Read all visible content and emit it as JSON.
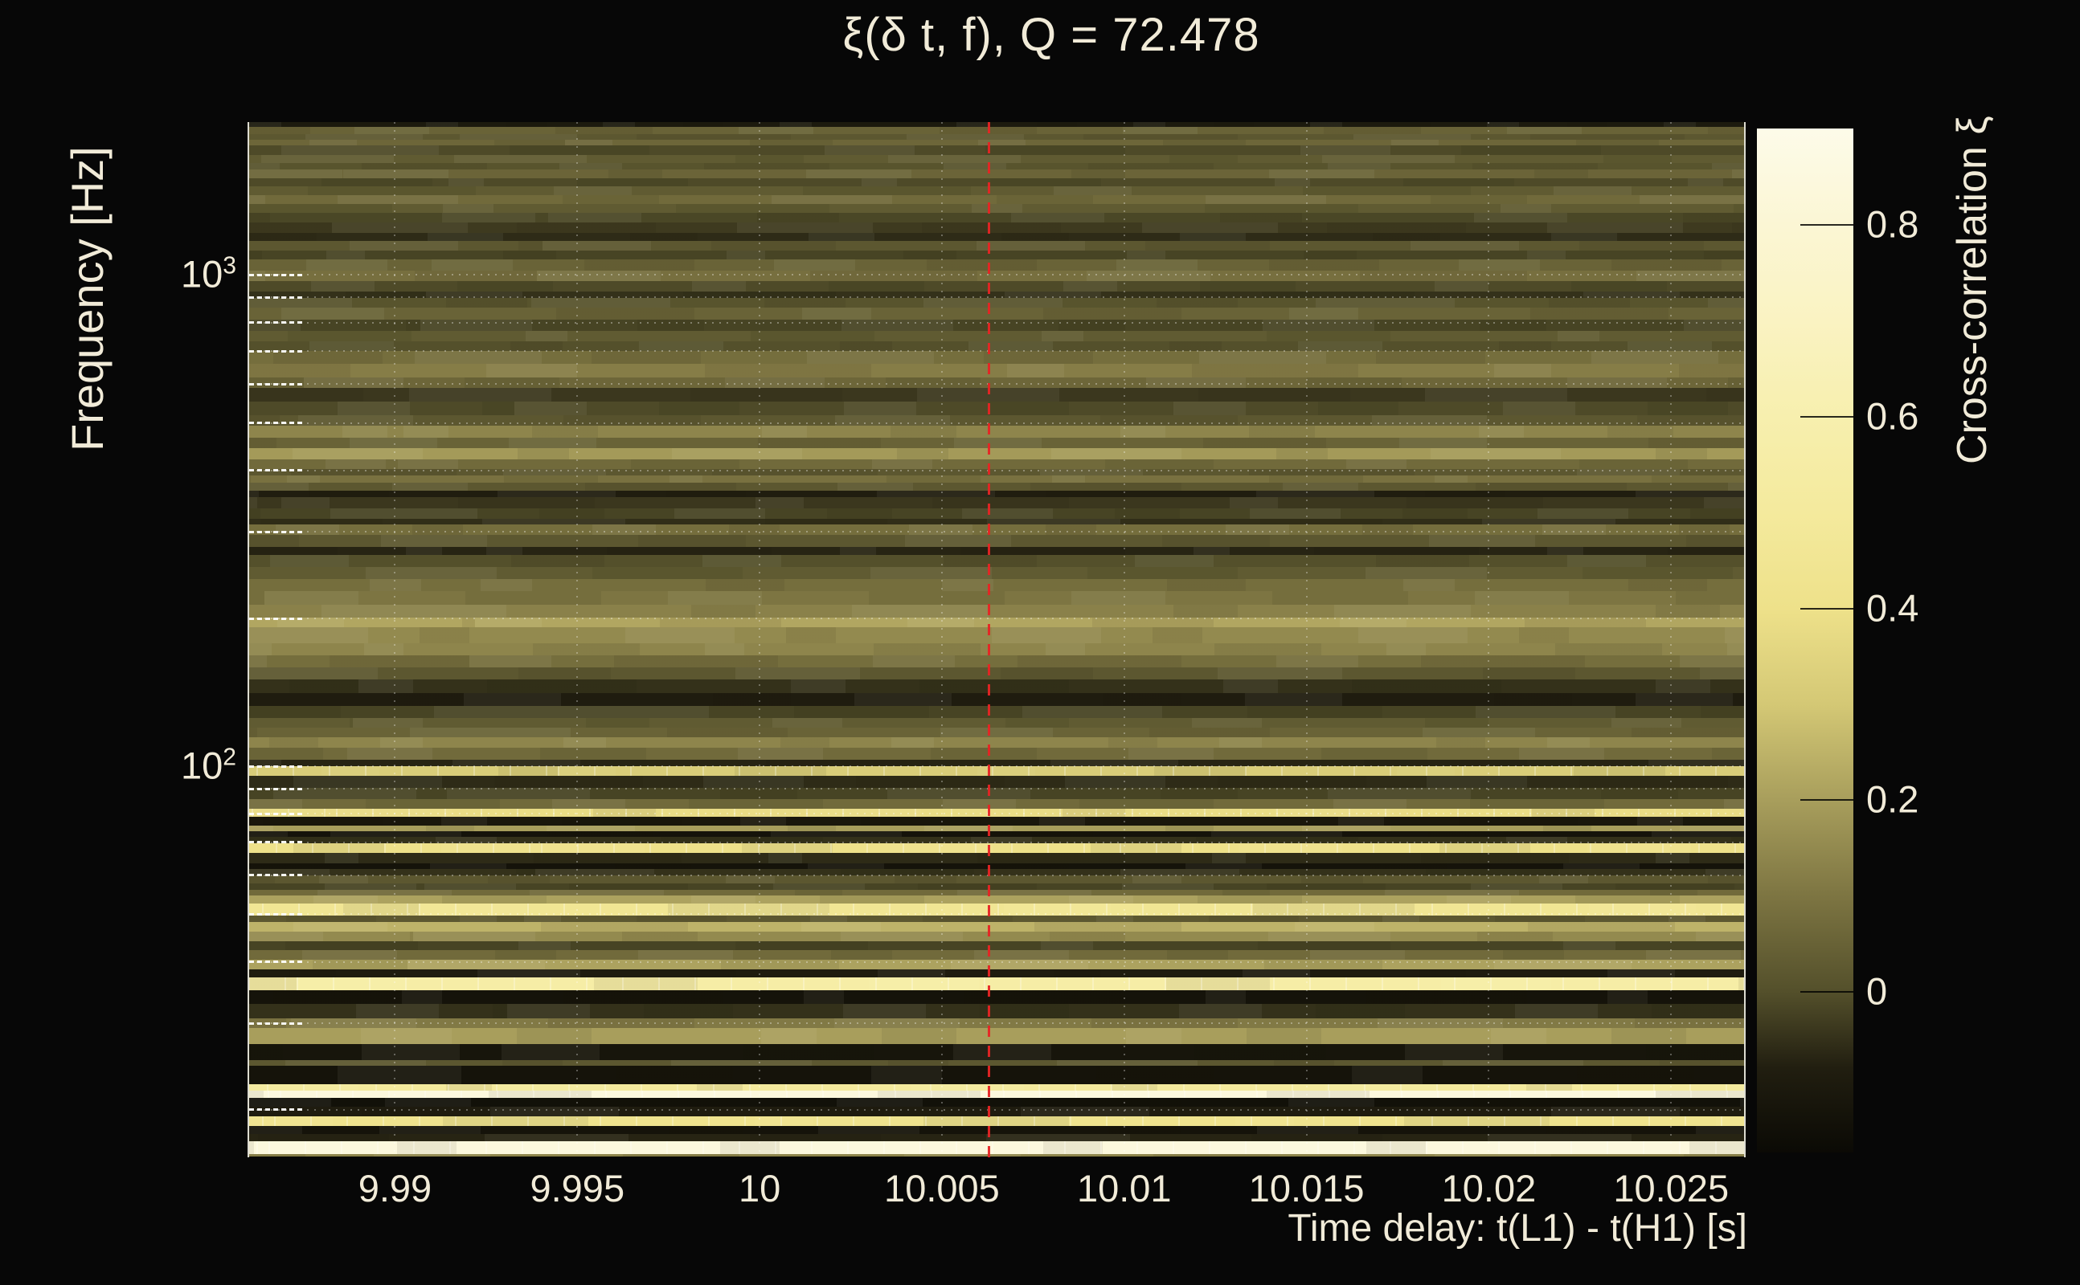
{
  "title": "ξ(δ t, f), Q = 72.478",
  "q_value": 72.478,
  "axes": {
    "x": {
      "label": "Time delay: t(L1) - t(H1) [s]"
    },
    "y": {
      "label": "Frequency [Hz]"
    }
  },
  "colorbar": {
    "label": "Cross-correlation ξ",
    "tick_labels": [
      "0.8",
      "0.6",
      "0.4",
      "0.2",
      "0"
    ]
  },
  "colors": {
    "background": "#070707",
    "text": "#f1ebd8",
    "marker_line": "#e62424",
    "grid": "#ffffff"
  },
  "chart_data": {
    "type": "heatmap",
    "title": "ξ(δ t, f), Q = 72.478",
    "xlabel": "Time delay: t(L1) - t(H1) [s]",
    "ylabel": "Frequency [Hz]",
    "x_range_s": [
      9.986,
      10.027
    ],
    "y_range_hz": [
      16,
      2048
    ],
    "y_scale": "log",
    "grid": true,
    "x_ticks": [
      {
        "label": "9.99",
        "value": 9.99
      },
      {
        "label": "9.995",
        "value": 9.995
      },
      {
        "label": "10",
        "value": 10.0
      },
      {
        "label": "10.005",
        "value": 10.005
      },
      {
        "label": "10.01",
        "value": 10.01
      },
      {
        "label": "10.015",
        "value": 10.015
      },
      {
        "label": "10.02",
        "value": 10.02
      },
      {
        "label": "10.025",
        "value": 10.025
      }
    ],
    "y_ticks": [
      {
        "label_base": "10",
        "label_exp": "3",
        "value_hz": 1000
      },
      {
        "label_base": "10",
        "label_exp": "2",
        "value_hz": 100
      }
    ],
    "h_gridlines_hz": [
      1000,
      900,
      800,
      700,
      600,
      500,
      400,
      300,
      200,
      100,
      90,
      80,
      70,
      60,
      50,
      40,
      30,
      20
    ],
    "v_gridlines_s": [
      9.99,
      9.995,
      10.0,
      10.005,
      10.01,
      10.015,
      10.02,
      10.025
    ],
    "marker_line": {
      "x_s": 10.0063,
      "color": "#e62424",
      "style": "dashed"
    },
    "colorbar": {
      "label": "Cross-correlation ξ",
      "range": [
        -0.168,
        0.901
      ],
      "ticks": [
        {
          "label": "0.8",
          "value": 0.8
        },
        {
          "label": "0.6",
          "value": 0.6
        },
        {
          "label": "0.4",
          "value": 0.4
        },
        {
          "label": "0.2",
          "value": 0.2
        },
        {
          "label": "0",
          "value": 0.0
        }
      ]
    },
    "colormap_stops": [
      [
        -0.17,
        "#0b0a05"
      ],
      [
        -0.08,
        "#211e10"
      ],
      [
        0.0,
        "#54502b"
      ],
      [
        0.1,
        "#7d7542"
      ],
      [
        0.2,
        "#a89e5c"
      ],
      [
        0.3,
        "#d4c875"
      ],
      [
        0.4,
        "#eee18a"
      ],
      [
        0.5,
        "#f4ea9d"
      ],
      [
        0.6,
        "#f7efae"
      ],
      [
        0.7,
        "#faf3c2"
      ],
      [
        0.8,
        "#fbf6d4"
      ],
      [
        0.92,
        "#fdfbe9"
      ]
    ],
    "rows_note": "stripe profile top(2048Hz)->bottom(16Hz): [relative_height_px, xi_value]",
    "rows": [
      [
        6,
        -0.1
      ],
      [
        9,
        0.05
      ],
      [
        7,
        0.02
      ],
      [
        7,
        0.06
      ],
      [
        12,
        -0.01
      ],
      [
        10,
        0.03
      ],
      [
        8,
        0.01
      ],
      [
        11,
        0.055
      ],
      [
        10,
        -0.01
      ],
      [
        11,
        0.03
      ],
      [
        11,
        0.07
      ],
      [
        11,
        0.03
      ],
      [
        12,
        -0.015
      ],
      [
        13,
        -0.035
      ],
      [
        10,
        -0.06
      ],
      [
        12,
        0.02
      ],
      [
        11,
        -0.02
      ],
      [
        14,
        0.05
      ],
      [
        13,
        0.085
      ],
      [
        13,
        -0.01
      ],
      [
        8,
        -0.05
      ],
      [
        12,
        0.01
      ],
      [
        15,
        0.05
      ],
      [
        14,
        -0.02
      ],
      [
        13,
        0.03
      ],
      [
        12,
        0.0
      ],
      [
        16,
        0.08
      ],
      [
        17,
        0.12
      ],
      [
        13,
        0.06
      ],
      [
        17,
        -0.04
      ],
      [
        17,
        -0.01
      ],
      [
        13,
        0.02
      ],
      [
        15,
        0.14
      ],
      [
        13,
        0.05
      ],
      [
        14,
        0.19
      ],
      [
        12,
        0.07
      ],
      [
        8,
        0.02
      ],
      [
        9,
        0.09
      ],
      [
        10,
        0.02
      ],
      [
        8,
        -0.085
      ],
      [
        14,
        -0.04
      ],
      [
        13,
        -0.02
      ],
      [
        7,
        -0.055
      ],
      [
        13,
        0.08
      ],
      [
        15,
        0.02
      ],
      [
        10,
        -0.07
      ],
      [
        15,
        0.0
      ],
      [
        15,
        0.03
      ],
      [
        15,
        0.08
      ],
      [
        17,
        0.1
      ],
      [
        16,
        0.13
      ],
      [
        12,
        0.22
      ],
      [
        20,
        0.15
      ],
      [
        15,
        0.14
      ],
      [
        15,
        0.08
      ],
      [
        15,
        0.02
      ],
      [
        17,
        -0.05
      ],
      [
        16,
        -0.09
      ],
      [
        15,
        -0.02
      ],
      [
        12,
        0.03
      ],
      [
        12,
        0.05
      ],
      [
        13,
        0.14
      ],
      [
        15,
        0.07
      ],
      [
        8,
        -0.07
      ],
      [
        12,
        0.32
      ],
      [
        15,
        -0.06
      ],
      [
        15,
        -0.02
      ],
      [
        12,
        0.07
      ],
      [
        10,
        0.38
      ],
      [
        11,
        -0.11
      ],
      [
        7,
        0.2
      ],
      [
        7,
        -0.13
      ],
      [
        8,
        -0.05
      ],
      [
        12,
        0.4
      ],
      [
        13,
        -0.06
      ],
      [
        7,
        -0.13
      ],
      [
        8,
        -0.05
      ],
      [
        10,
        0.02
      ],
      [
        8,
        -0.02
      ],
      [
        7,
        0.07
      ],
      [
        10,
        0.21
      ],
      [
        15,
        0.45
      ],
      [
        8,
        0.02
      ],
      [
        12,
        0.25
      ],
      [
        12,
        0.15
      ],
      [
        11,
        -0.02
      ],
      [
        12,
        0.07
      ],
      [
        12,
        0.21
      ],
      [
        10,
        -0.09
      ],
      [
        16,
        0.55
      ],
      [
        17,
        -0.13
      ],
      [
        18,
        -0.05
      ],
      [
        12,
        0.11
      ],
      [
        20,
        0.2
      ],
      [
        20,
        -0.12
      ],
      [
        7,
        0.02
      ],
      [
        23,
        -0.13
      ],
      [
        8,
        0.5
      ],
      [
        9,
        0.85
      ],
      [
        11,
        -0.14
      ],
      [
        12,
        -0.09
      ],
      [
        12,
        0.42
      ],
      [
        10,
        -0.13
      ],
      [
        9,
        -0.07
      ],
      [
        16,
        0.85
      ],
      [
        3,
        0.14
      ]
    ]
  }
}
